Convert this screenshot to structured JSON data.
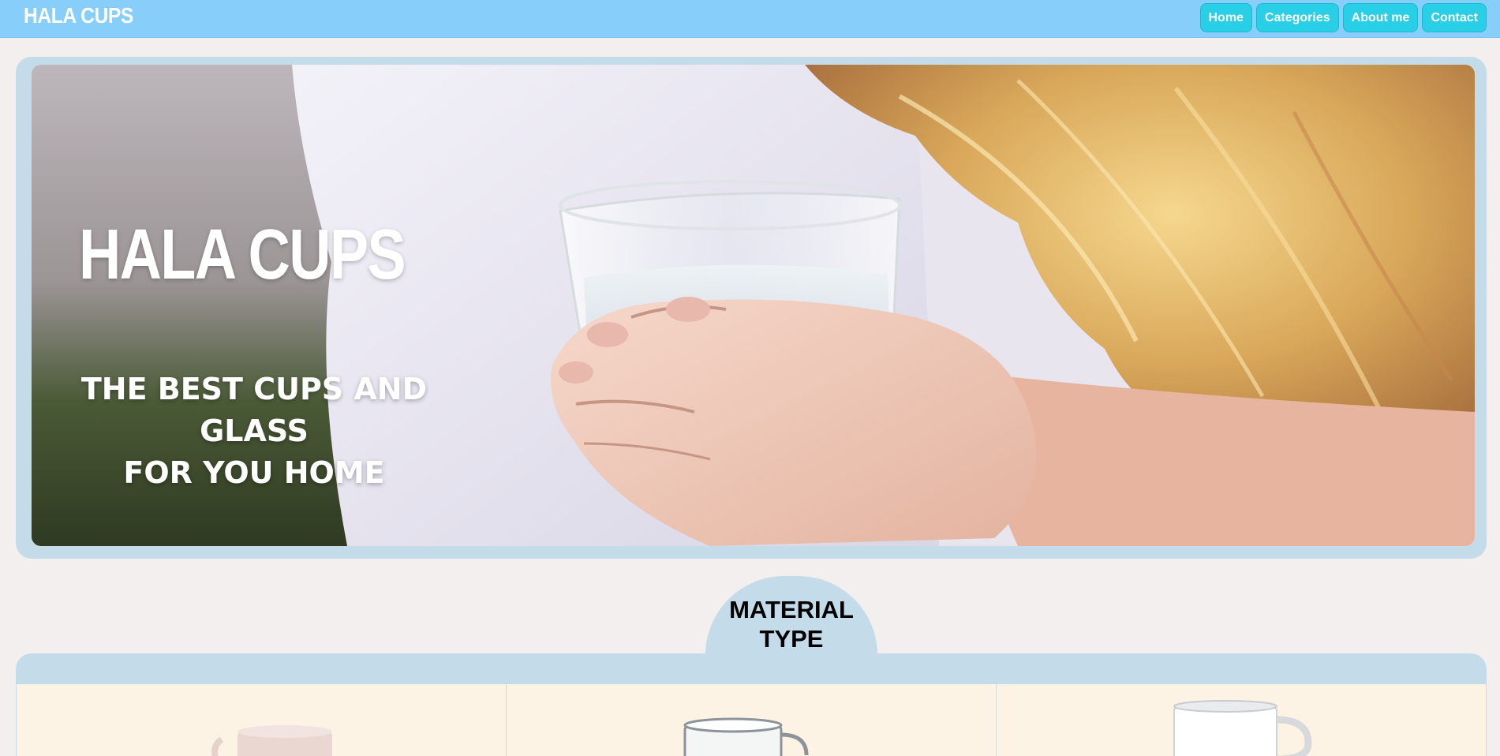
{
  "navbar": {
    "brand": "HALA CUPS",
    "links": [
      "Home",
      "Categories",
      "About me",
      "Contact"
    ],
    "background_color": "#87cefa",
    "button_color": "#29cfe6"
  },
  "hero": {
    "title": "HALA CUPS",
    "subtitle_line1": "THE BEST CUPS AND GLASS",
    "subtitle_line2": "FOR YOU HOME",
    "frame_color": "#c4dbe9"
  },
  "section": {
    "title_line1": "MATERIAL",
    "title_line2": "TYPE"
  },
  "cards": [
    {
      "icon": "frosted-glass-mug-icon"
    },
    {
      "icon": "clear-glass-mug-icon"
    },
    {
      "icon": "white-ceramic-mug-icon"
    }
  ]
}
